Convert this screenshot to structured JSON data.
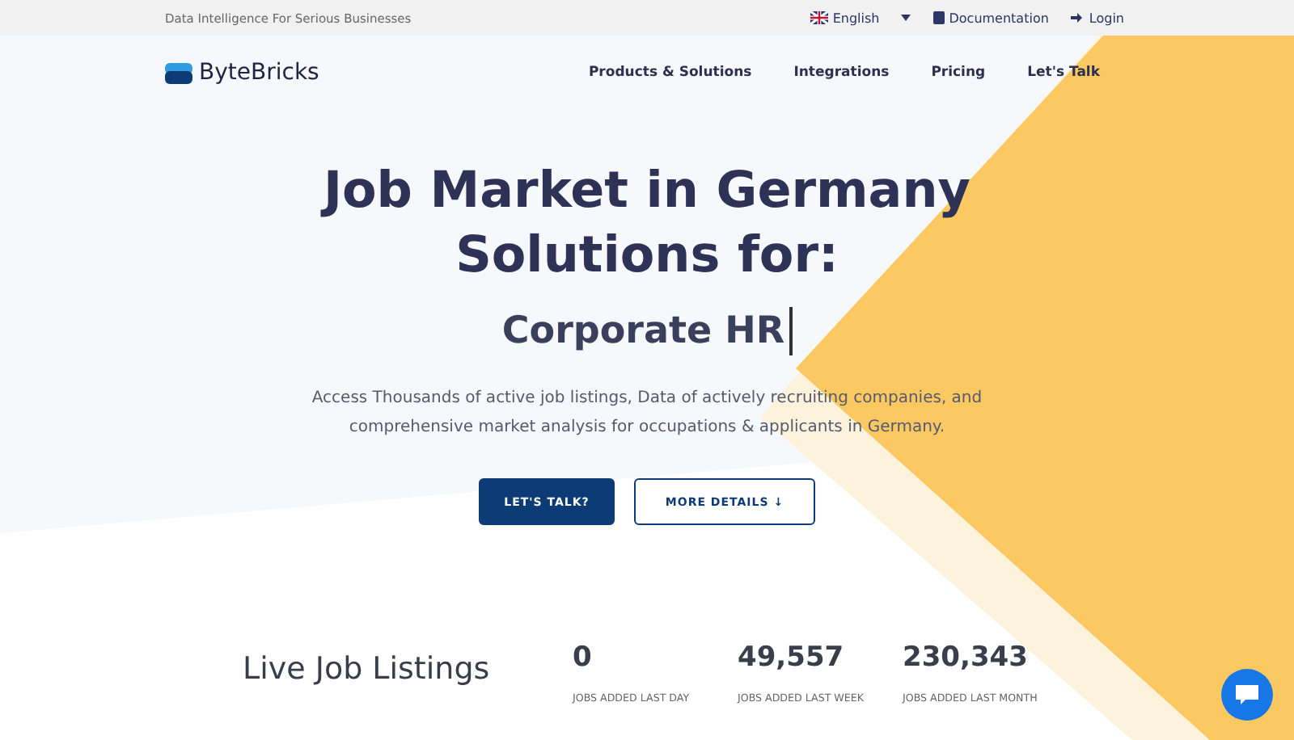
{
  "topbar": {
    "tagline": "Data Intelligence For Serious Businesses",
    "language": "English",
    "links": [
      "Documentation",
      "Login"
    ]
  },
  "nav": {
    "brand": "ByteBricks",
    "items": [
      "Products & Solutions",
      "Integrations",
      "Pricing",
      "Let's Talk"
    ]
  },
  "hero": {
    "title_lines": [
      "Job Market in Germany",
      "Solutions for:"
    ],
    "typed": "Corporate HR",
    "description": "Access Thousands of active job listings, Data of actively recruiting companies, and comprehensive market analysis for occupations & applicants in Germany.",
    "buttons": [
      {
        "label": "LET'S TALK?",
        "kind": "primary"
      },
      {
        "label": "MORE DETAILS ↓",
        "kind": "outline"
      }
    ]
  },
  "stats": {
    "title": "Live Job Listings",
    "items": [
      {
        "value": "0",
        "label": "JOBS ADDED LAST DAY"
      },
      {
        "value": "49,557",
        "label": "JOBS ADDED LAST WEEK"
      },
      {
        "value": "230,343",
        "label": "JOBS ADDED LAST MONTH"
      }
    ]
  }
}
